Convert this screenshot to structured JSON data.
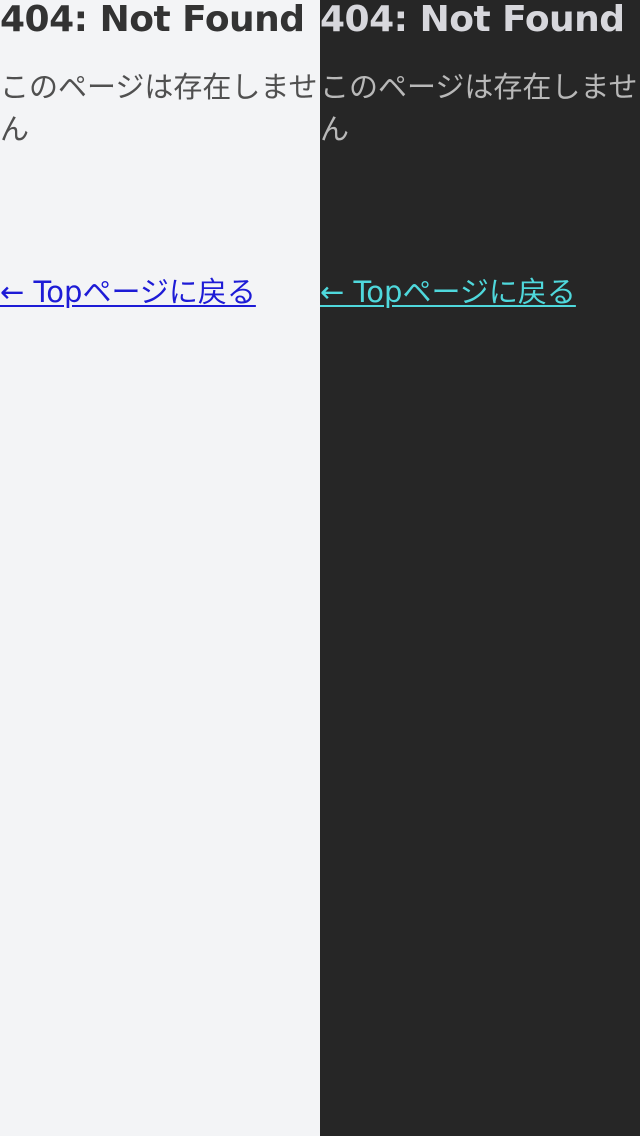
{
  "light_pane": {
    "title": "404: Not Found",
    "message": "このページは存在しません",
    "back_link": "← Topページに戻る"
  },
  "dark_pane": {
    "title": "404: Not Found",
    "message": "このページは存在しません",
    "back_link": "← Topページに戻る"
  },
  "colors": {
    "light_background": "#f3f4f6",
    "dark_background": "#262626",
    "light_link": "#1d1bd6",
    "dark_link": "#4fd8dc"
  }
}
